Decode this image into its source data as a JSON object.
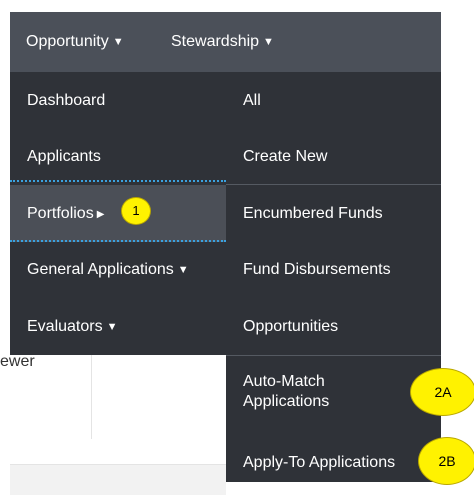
{
  "topnav": {
    "opportunity": "Opportunity",
    "stewardship": "Stewardship"
  },
  "left_menu": {
    "dashboard": "Dashboard",
    "applicants": "Applicants",
    "portfolios": "Portfolios",
    "general_applications": "General Applications",
    "evaluators": "Evaluators"
  },
  "right_menu": {
    "all": "All",
    "create_new": "Create New",
    "encumbered_funds": "Encumbered Funds",
    "fund_disbursements": "Fund Disbursements",
    "opportunities": "Opportunities",
    "auto_match_line1": "Auto-Match",
    "auto_match_line2": "Applications",
    "apply_to": "Apply-To Applications"
  },
  "callouts": {
    "one": "1",
    "two_a": "2A",
    "two_b": "2B"
  },
  "background": {
    "partial_text": "ewer"
  },
  "icons": {
    "caret": "▼",
    "submenu_arrow": "▶"
  },
  "colors": {
    "topbar": "#4b5059",
    "menu": "#2f3238",
    "highlight": "#4b4f57",
    "dotted_accent": "#3aa2e0",
    "callout": "#fff200"
  }
}
